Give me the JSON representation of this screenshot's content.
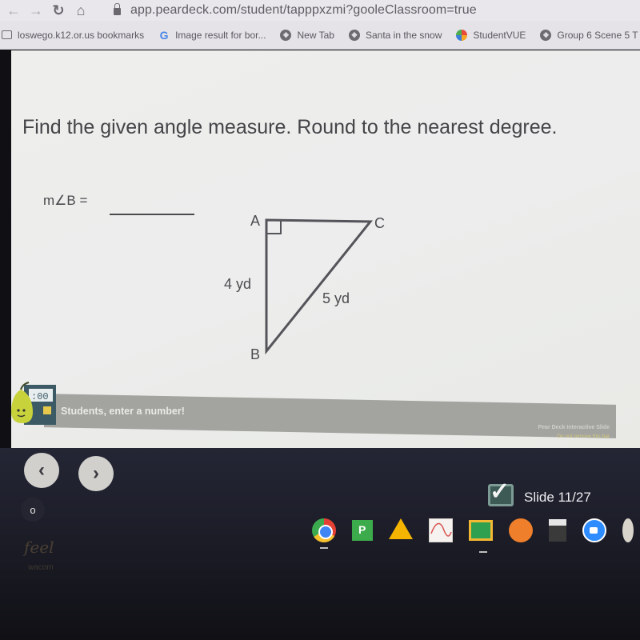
{
  "browser": {
    "url": "app.peardeck.com/student/tapppxzmi?gooleClassroom=true",
    "nav_icons": [
      "back-arrow-icon",
      "forward-arrow-icon",
      "reload-icon",
      "home-icon",
      "lock-icon"
    ],
    "bookmarks": [
      {
        "label": "loswego.k12.or.us bookmarks",
        "icon": "folder-icon"
      },
      {
        "label": "Image result for bor...",
        "icon": "google-icon"
      },
      {
        "label": "New Tab",
        "icon": "globe-icon"
      },
      {
        "label": "Santa in the snow",
        "icon": "globe-icon"
      },
      {
        "label": "StudentVUE",
        "icon": "studentvue-icon"
      },
      {
        "label": "Group 6 Scene 5 T",
        "icon": "globe-icon"
      }
    ]
  },
  "slide": {
    "question": "Find the given angle measure. Round to the nearest degree.",
    "prompt": "m∠B =",
    "answer_value": "",
    "figure": {
      "vertices": [
        "A",
        "B",
        "C"
      ],
      "right_angle_at": "A",
      "side_AB_label": "4 yd",
      "side_BC_label": "5 yd"
    }
  },
  "peardeck_bar": {
    "instruction": "Students, enter a number!",
    "brand": "Pear Deck Interactive Slide",
    "note": "Do not remove this bar",
    "icon": "pear-number-icon",
    "accent_color": "#d4d44a"
  },
  "player": {
    "prev_label": "‹",
    "next_label": "›",
    "slide_counter": "Slide 11/27",
    "submitted": true
  },
  "shelf": {
    "launcher_label": "o",
    "apps": [
      "chrome-icon",
      "peardeck-app-icon",
      "google-drive-icon",
      "graph-app-icon",
      "google-classroom-icon",
      "share-app-icon",
      "calculator-icon",
      "zoom-icon",
      "partial-app-icon"
    ]
  },
  "bezel": {
    "sticker_text": "feel",
    "sticker_sub": "wacom"
  }
}
